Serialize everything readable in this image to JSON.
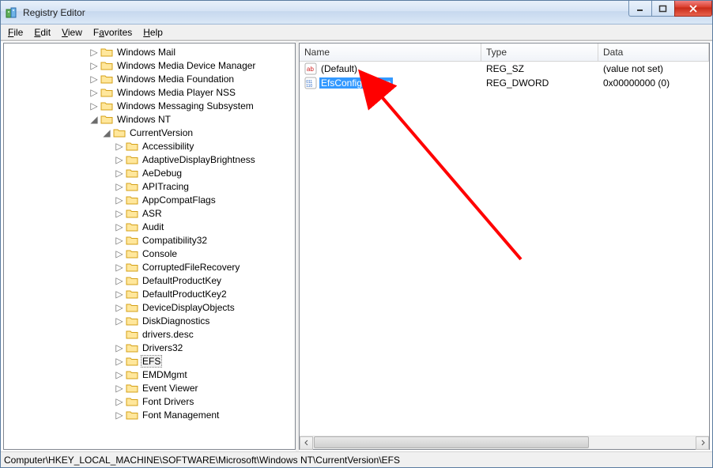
{
  "window": {
    "title": "Registry Editor"
  },
  "menu": {
    "file": "File",
    "edit": "Edit",
    "view": "View",
    "favorites": "Favorites",
    "help": "Help",
    "file_u": "F",
    "edit_u": "E",
    "view_u": "V",
    "favorites_u": "a",
    "help_u": "H"
  },
  "tree": {
    "nodes": {
      "windows_mail": "Windows Mail",
      "windows_mdm": "Windows Media Device Manager",
      "windows_mf": "Windows Media Foundation",
      "windows_mpnss": "Windows Media Player NSS",
      "windows_msgsub": "Windows Messaging Subsystem",
      "windows_nt": "Windows NT",
      "currentversion": "CurrentVersion",
      "accessibility": "Accessibility",
      "adb": "AdaptiveDisplayBrightness",
      "aedebug": "AeDebug",
      "apitracing": "APITracing",
      "appcompat": "AppCompatFlags",
      "asr": "ASR",
      "audit": "Audit",
      "compat32": "Compatibility32",
      "console": "Console",
      "corrupted": "CorruptedFileRecovery",
      "defprodkey": "DefaultProductKey",
      "defprodkey2": "DefaultProductKey2",
      "devicedisp": "DeviceDisplayObjects",
      "diskdiag": "DiskDiagnostics",
      "driversdesc": "drivers.desc",
      "drivers32": "Drivers32",
      "efs": "EFS",
      "emdmgmt": "EMDMgmt",
      "eventviewer": "Event Viewer",
      "fontdrivers": "Font Drivers",
      "fontmgmt": "Font Management"
    }
  },
  "list": {
    "headers": {
      "name": "Name",
      "type": "Type",
      "data": "Data"
    },
    "rows": [
      {
        "icon": "ab",
        "name": "(Default)",
        "type": "REG_SZ",
        "data": "(value not set)",
        "selected": false
      },
      {
        "icon": "bin",
        "name": "EfsConfiguration",
        "type": "REG_DWORD",
        "data": "0x00000000 (0)",
        "selected": true
      }
    ]
  },
  "statusbar": {
    "path": "Computer\\HKEY_LOCAL_MACHINE\\SOFTWARE\\Microsoft\\Windows NT\\CurrentVersion\\EFS"
  }
}
